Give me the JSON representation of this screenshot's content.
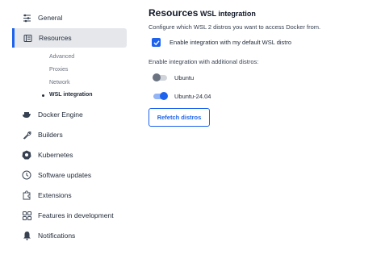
{
  "sidebar": {
    "items": [
      {
        "label": "General",
        "icon": "sliders-icon"
      },
      {
        "label": "Resources",
        "icon": "resources-icon"
      },
      {
        "label": "Docker Engine",
        "icon": "whale-icon"
      },
      {
        "label": "Builders",
        "icon": "wrench-icon"
      },
      {
        "label": "Kubernetes",
        "icon": "kubernetes-icon"
      },
      {
        "label": "Software updates",
        "icon": "clock-icon"
      },
      {
        "label": "Extensions",
        "icon": "puzzle-icon"
      },
      {
        "label": "Features in development",
        "icon": "grid-icon"
      },
      {
        "label": "Notifications",
        "icon": "bell-icon"
      }
    ],
    "subitems": [
      "Advanced",
      "Proxies",
      "Network",
      "WSL integration"
    ]
  },
  "main": {
    "title": "Resources",
    "subtitle": "WSL integration",
    "description": "Configure which WSL 2 distros you want to access Docker from.",
    "default_checkbox_label": "Enable integration with my default WSL distro",
    "default_checked": true,
    "additional_label": "Enable integration with additional distros:",
    "distros": [
      {
        "name": "Ubuntu",
        "enabled": false
      },
      {
        "name": "Ubuntu-24.04",
        "enabled": true
      }
    ],
    "refetch_button": "Refetch distros"
  },
  "colors": {
    "accent": "#1d63ed",
    "active_bg": "#e5e7eb"
  }
}
